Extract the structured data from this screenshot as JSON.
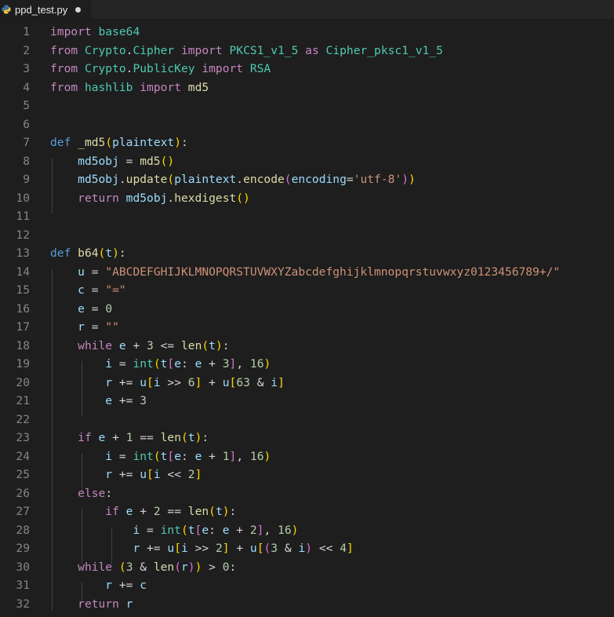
{
  "tab": {
    "filename": "ppd_test.py",
    "icon": "python-file-icon",
    "dirty": true
  },
  "colors": {
    "background": "#1e1e1e",
    "keyword": "#569cd6",
    "control": "#c586c0",
    "function": "#dcdcaa",
    "variable": "#9cdcfe",
    "string": "#ce9178",
    "number": "#b5cea8",
    "module": "#4ec9b0"
  },
  "lines": [
    {
      "n": "1",
      "tokens": [
        [
          "kw-import",
          "import"
        ],
        [
          "op",
          " "
        ],
        [
          "mod",
          "base64"
        ]
      ]
    },
    {
      "n": "2",
      "tokens": [
        [
          "kw-import",
          "from"
        ],
        [
          "op",
          " "
        ],
        [
          "mod",
          "Crypto"
        ],
        [
          "op",
          "."
        ],
        [
          "mod",
          "Cipher"
        ],
        [
          "op",
          " "
        ],
        [
          "kw-import",
          "import"
        ],
        [
          "op",
          " "
        ],
        [
          "cls",
          "PKCS1_v1_5"
        ],
        [
          "op",
          " "
        ],
        [
          "kw-import",
          "as"
        ],
        [
          "op",
          " "
        ],
        [
          "cls",
          "Cipher_pksc1_v1_5"
        ]
      ]
    },
    {
      "n": "3",
      "tokens": [
        [
          "kw-import",
          "from"
        ],
        [
          "op",
          " "
        ],
        [
          "mod",
          "Crypto"
        ],
        [
          "op",
          "."
        ],
        [
          "mod",
          "PublicKey"
        ],
        [
          "op",
          " "
        ],
        [
          "kw-import",
          "import"
        ],
        [
          "op",
          " "
        ],
        [
          "cls",
          "RSA"
        ]
      ]
    },
    {
      "n": "4",
      "tokens": [
        [
          "kw-import",
          "from"
        ],
        [
          "op",
          " "
        ],
        [
          "mod",
          "hashlib"
        ],
        [
          "op",
          " "
        ],
        [
          "kw-import",
          "import"
        ],
        [
          "op",
          " "
        ],
        [
          "fn",
          "md5"
        ]
      ]
    },
    {
      "n": "5",
      "tokens": []
    },
    {
      "n": "6",
      "tokens": []
    },
    {
      "n": "7",
      "tokens": [
        [
          "kw",
          "def"
        ],
        [
          "op",
          " "
        ],
        [
          "fn",
          "_md5"
        ],
        [
          "p1",
          "("
        ],
        [
          "var",
          "plaintext"
        ],
        [
          "p1",
          ")"
        ],
        [
          "op",
          ":"
        ]
      ]
    },
    {
      "n": "8",
      "tokens": [
        [
          "op",
          "    "
        ],
        [
          "var",
          "md5obj"
        ],
        [
          "op",
          " = "
        ],
        [
          "fn",
          "md5"
        ],
        [
          "p1",
          "()"
        ]
      ]
    },
    {
      "n": "9",
      "tokens": [
        [
          "op",
          "    "
        ],
        [
          "var",
          "md5obj"
        ],
        [
          "op",
          "."
        ],
        [
          "fn",
          "update"
        ],
        [
          "p1",
          "("
        ],
        [
          "var",
          "plaintext"
        ],
        [
          "op",
          "."
        ],
        [
          "fn",
          "encode"
        ],
        [
          "p2",
          "("
        ],
        [
          "var",
          "encoding"
        ],
        [
          "op",
          "="
        ],
        [
          "str",
          "'utf-8'"
        ],
        [
          "p2",
          ")"
        ],
        [
          "p1",
          ")"
        ]
      ]
    },
    {
      "n": "10",
      "tokens": [
        [
          "op",
          "    "
        ],
        [
          "kw-ctrl",
          "return"
        ],
        [
          "op",
          " "
        ],
        [
          "var",
          "md5obj"
        ],
        [
          "op",
          "."
        ],
        [
          "fn",
          "hexdigest"
        ],
        [
          "p1",
          "()"
        ]
      ]
    },
    {
      "n": "11",
      "tokens": []
    },
    {
      "n": "12",
      "tokens": []
    },
    {
      "n": "13",
      "tokens": [
        [
          "kw",
          "def"
        ],
        [
          "op",
          " "
        ],
        [
          "fn",
          "b64"
        ],
        [
          "p1",
          "("
        ],
        [
          "var",
          "t"
        ],
        [
          "p1",
          ")"
        ],
        [
          "op",
          ":"
        ]
      ]
    },
    {
      "n": "14",
      "tokens": [
        [
          "op",
          "    "
        ],
        [
          "var",
          "u"
        ],
        [
          "op",
          " = "
        ],
        [
          "str",
          "\"ABCDEFGHIJKLMNOPQRSTUVWXYZabcdefghijklmnopqrstuvwxyz0123456789+/\""
        ]
      ]
    },
    {
      "n": "15",
      "tokens": [
        [
          "op",
          "    "
        ],
        [
          "var",
          "c"
        ],
        [
          "op",
          " = "
        ],
        [
          "str",
          "\"=\""
        ]
      ]
    },
    {
      "n": "16",
      "tokens": [
        [
          "op",
          "    "
        ],
        [
          "var",
          "e"
        ],
        [
          "op",
          " = "
        ],
        [
          "num",
          "0"
        ]
      ]
    },
    {
      "n": "17",
      "tokens": [
        [
          "op",
          "    "
        ],
        [
          "var",
          "r"
        ],
        [
          "op",
          " = "
        ],
        [
          "str",
          "\"\""
        ]
      ]
    },
    {
      "n": "18",
      "tokens": [
        [
          "op",
          "    "
        ],
        [
          "kw-ctrl",
          "while"
        ],
        [
          "op",
          " "
        ],
        [
          "var",
          "e"
        ],
        [
          "op",
          " + "
        ],
        [
          "num",
          "3"
        ],
        [
          "op",
          " <= "
        ],
        [
          "fn",
          "len"
        ],
        [
          "p1",
          "("
        ],
        [
          "var",
          "t"
        ],
        [
          "p1",
          ")"
        ],
        [
          "op",
          ":"
        ]
      ]
    },
    {
      "n": "19",
      "tokens": [
        [
          "op",
          "        "
        ],
        [
          "var",
          "i"
        ],
        [
          "op",
          " = "
        ],
        [
          "cls",
          "int"
        ],
        [
          "p1",
          "("
        ],
        [
          "var",
          "t"
        ],
        [
          "p2",
          "["
        ],
        [
          "var",
          "e"
        ],
        [
          "op",
          ": "
        ],
        [
          "var",
          "e"
        ],
        [
          "op",
          " + "
        ],
        [
          "num",
          "3"
        ],
        [
          "p2",
          "]"
        ],
        [
          "op",
          ", "
        ],
        [
          "num",
          "16"
        ],
        [
          "p1",
          ")"
        ]
      ]
    },
    {
      "n": "20",
      "tokens": [
        [
          "op",
          "        "
        ],
        [
          "var",
          "r"
        ],
        [
          "op",
          " += "
        ],
        [
          "var",
          "u"
        ],
        [
          "p1",
          "["
        ],
        [
          "var",
          "i"
        ],
        [
          "op",
          " >> "
        ],
        [
          "num",
          "6"
        ],
        [
          "p1",
          "]"
        ],
        [
          "op",
          " + "
        ],
        [
          "var",
          "u"
        ],
        [
          "p1",
          "["
        ],
        [
          "num",
          "63"
        ],
        [
          "op",
          " & "
        ],
        [
          "var",
          "i"
        ],
        [
          "p1",
          "]"
        ]
      ]
    },
    {
      "n": "21",
      "tokens": [
        [
          "op",
          "        "
        ],
        [
          "var",
          "e"
        ],
        [
          "op",
          " += "
        ],
        [
          "num",
          "3"
        ]
      ]
    },
    {
      "n": "22",
      "tokens": []
    },
    {
      "n": "23",
      "tokens": [
        [
          "op",
          "    "
        ],
        [
          "kw-ctrl",
          "if"
        ],
        [
          "op",
          " "
        ],
        [
          "var",
          "e"
        ],
        [
          "op",
          " + "
        ],
        [
          "num",
          "1"
        ],
        [
          "op",
          " == "
        ],
        [
          "fn",
          "len"
        ],
        [
          "p1",
          "("
        ],
        [
          "var",
          "t"
        ],
        [
          "p1",
          ")"
        ],
        [
          "op",
          ":"
        ]
      ]
    },
    {
      "n": "24",
      "tokens": [
        [
          "op",
          "        "
        ],
        [
          "var",
          "i"
        ],
        [
          "op",
          " = "
        ],
        [
          "cls",
          "int"
        ],
        [
          "p1",
          "("
        ],
        [
          "var",
          "t"
        ],
        [
          "p2",
          "["
        ],
        [
          "var",
          "e"
        ],
        [
          "op",
          ": "
        ],
        [
          "var",
          "e"
        ],
        [
          "op",
          " + "
        ],
        [
          "num",
          "1"
        ],
        [
          "p2",
          "]"
        ],
        [
          "op",
          ", "
        ],
        [
          "num",
          "16"
        ],
        [
          "p1",
          ")"
        ]
      ]
    },
    {
      "n": "25",
      "tokens": [
        [
          "op",
          "        "
        ],
        [
          "var",
          "r"
        ],
        [
          "op",
          " += "
        ],
        [
          "var",
          "u"
        ],
        [
          "p1",
          "["
        ],
        [
          "var",
          "i"
        ],
        [
          "op",
          " << "
        ],
        [
          "num",
          "2"
        ],
        [
          "p1",
          "]"
        ]
      ]
    },
    {
      "n": "26",
      "tokens": [
        [
          "op",
          "    "
        ],
        [
          "kw-ctrl",
          "else"
        ],
        [
          "op",
          ":"
        ]
      ]
    },
    {
      "n": "27",
      "tokens": [
        [
          "op",
          "        "
        ],
        [
          "kw-ctrl",
          "if"
        ],
        [
          "op",
          " "
        ],
        [
          "var",
          "e"
        ],
        [
          "op",
          " + "
        ],
        [
          "num",
          "2"
        ],
        [
          "op",
          " == "
        ],
        [
          "fn",
          "len"
        ],
        [
          "p1",
          "("
        ],
        [
          "var",
          "t"
        ],
        [
          "p1",
          ")"
        ],
        [
          "op",
          ":"
        ]
      ]
    },
    {
      "n": "28",
      "tokens": [
        [
          "op",
          "            "
        ],
        [
          "var",
          "i"
        ],
        [
          "op",
          " = "
        ],
        [
          "cls",
          "int"
        ],
        [
          "p1",
          "("
        ],
        [
          "var",
          "t"
        ],
        [
          "p2",
          "["
        ],
        [
          "var",
          "e"
        ],
        [
          "op",
          ": "
        ],
        [
          "var",
          "e"
        ],
        [
          "op",
          " + "
        ],
        [
          "num",
          "2"
        ],
        [
          "p2",
          "]"
        ],
        [
          "op",
          ", "
        ],
        [
          "num",
          "16"
        ],
        [
          "p1",
          ")"
        ]
      ]
    },
    {
      "n": "29",
      "tokens": [
        [
          "op",
          "            "
        ],
        [
          "var",
          "r"
        ],
        [
          "op",
          " += "
        ],
        [
          "var",
          "u"
        ],
        [
          "p1",
          "["
        ],
        [
          "var",
          "i"
        ],
        [
          "op",
          " >> "
        ],
        [
          "num",
          "2"
        ],
        [
          "p1",
          "]"
        ],
        [
          "op",
          " + "
        ],
        [
          "var",
          "u"
        ],
        [
          "p1",
          "["
        ],
        [
          "p2",
          "("
        ],
        [
          "num",
          "3"
        ],
        [
          "op",
          " & "
        ],
        [
          "var",
          "i"
        ],
        [
          "p2",
          ")"
        ],
        [
          "op",
          " << "
        ],
        [
          "num",
          "4"
        ],
        [
          "p1",
          "]"
        ]
      ]
    },
    {
      "n": "30",
      "tokens": [
        [
          "op",
          "    "
        ],
        [
          "kw-ctrl",
          "while"
        ],
        [
          "op",
          " "
        ],
        [
          "p1",
          "("
        ],
        [
          "num",
          "3"
        ],
        [
          "op",
          " & "
        ],
        [
          "fn",
          "len"
        ],
        [
          "p2",
          "("
        ],
        [
          "var",
          "r"
        ],
        [
          "p2",
          ")"
        ],
        [
          "p1",
          ")"
        ],
        [
          "op",
          " > "
        ],
        [
          "num",
          "0"
        ],
        [
          "op",
          ":"
        ]
      ]
    },
    {
      "n": "31",
      "tokens": [
        [
          "op",
          "        "
        ],
        [
          "var",
          "r"
        ],
        [
          "op",
          " += "
        ],
        [
          "var",
          "c"
        ]
      ]
    },
    {
      "n": "32",
      "tokens": [
        [
          "op",
          "    "
        ],
        [
          "kw-ctrl",
          "return"
        ],
        [
          "op",
          " "
        ],
        [
          "var",
          "r"
        ]
      ]
    }
  ]
}
